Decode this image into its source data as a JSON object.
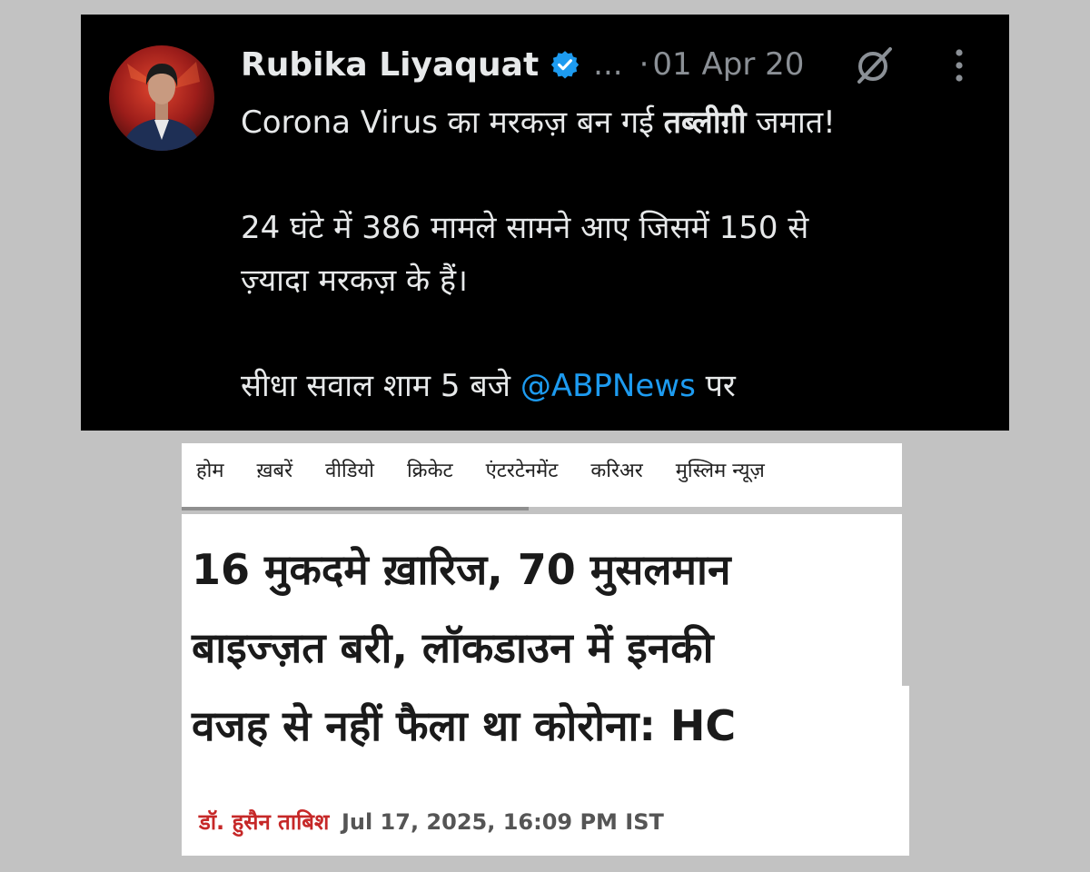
{
  "tweet": {
    "author_name": "Rubika Liyaquat",
    "handle_ellipsis": "...",
    "separator": "·",
    "date": "01 Apr 20",
    "body": {
      "line1_prefix": "Corona Virus का मरकज़ बन गई ",
      "line1_bold": "तब्लीग़ी",
      "line1_suffix": " जमात!",
      "line2": "24 घंटे में 386 मामले सामने आए जिसमें 150 से",
      "line3": "ज़्यादा मरकज़ के हैं।",
      "line4_prefix": "सीधा सवाल शाम 5 बजे ",
      "line4_mention": "@ABPNews",
      "line4_suffix": " पर"
    },
    "icons": {
      "verified": "verified-badge-icon",
      "grok": "grok-icon",
      "more": "more-options-icon"
    },
    "colors": {
      "background": "#000000",
      "text": "#e7e9ea",
      "muted": "#8b9096",
      "link": "#1d9bf0",
      "verified": "#1d9bf0"
    }
  },
  "news": {
    "nav": [
      "होम",
      "ख़बरें",
      "वीडियो",
      "क्रिकेट",
      "एंटरटेनमेंट",
      "करिअर",
      "मुस्लिम न्यूज़"
    ],
    "headline_lines": [
      "16 मुकदमे ख़ारिज, 70 मुसलमान",
      "बाइज्ज़त बरी, लॉकडाउन में इनकी",
      "वजह से नहीं फैला था कोरोना: HC"
    ],
    "byline_author": "डॉ. हुसैन ताबिश",
    "byline_date": "Jul 17, 2025, 16:09 PM IST",
    "colors": {
      "author": "#c62828",
      "headline": "#1a1a1a",
      "date": "#555555"
    }
  }
}
